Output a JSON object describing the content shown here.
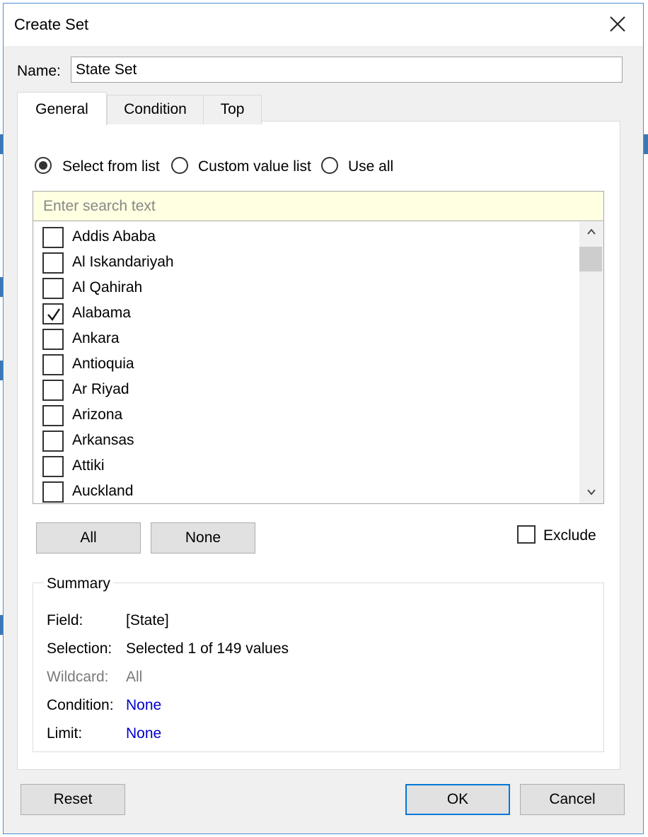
{
  "window": {
    "title": "Create Set",
    "close_icon": "close-icon"
  },
  "name": {
    "label": "Name:",
    "value": "State Set"
  },
  "tabs": [
    {
      "label": "General",
      "active": true
    },
    {
      "label": "Condition",
      "active": false
    },
    {
      "label": "Top",
      "active": false
    }
  ],
  "mode": {
    "options": [
      {
        "label": "Select from list",
        "selected": true
      },
      {
        "label": "Custom value list",
        "selected": false
      },
      {
        "label": "Use all",
        "selected": false
      }
    ]
  },
  "search": {
    "placeholder": "Enter search text"
  },
  "list": {
    "items": [
      {
        "label": "Addis Ababa",
        "checked": false
      },
      {
        "label": "Al Iskandariyah",
        "checked": false
      },
      {
        "label": "Al Qahirah",
        "checked": false
      },
      {
        "label": "Alabama",
        "checked": true
      },
      {
        "label": "Ankara",
        "checked": false
      },
      {
        "label": "Antioquia",
        "checked": false
      },
      {
        "label": "Ar Riyad",
        "checked": false
      },
      {
        "label": "Arizona",
        "checked": false
      },
      {
        "label": "Arkansas",
        "checked": false
      },
      {
        "label": "Attiki",
        "checked": false
      },
      {
        "label": "Auckland",
        "checked": false
      }
    ]
  },
  "list_buttons": {
    "all": "All",
    "none": "None"
  },
  "exclude": {
    "label": "Exclude",
    "checked": false
  },
  "summary": {
    "legend": "Summary",
    "rows": [
      {
        "key": "Field:",
        "value": "[State]",
        "style": "normal"
      },
      {
        "key": "Selection:",
        "value": "Selected 1 of 149 values",
        "style": "normal"
      },
      {
        "key": "Wildcard:",
        "value": "All",
        "style": "muted"
      },
      {
        "key": "Condition:",
        "value": "None",
        "style": "link"
      },
      {
        "key": "Limit:",
        "value": "None",
        "style": "link"
      }
    ]
  },
  "footer": {
    "reset": "Reset",
    "ok": "OK",
    "cancel": "Cancel"
  },
  "colors": {
    "accent": "#0078d7",
    "link": "#0000cc",
    "search_bg": "#ffffe1"
  }
}
